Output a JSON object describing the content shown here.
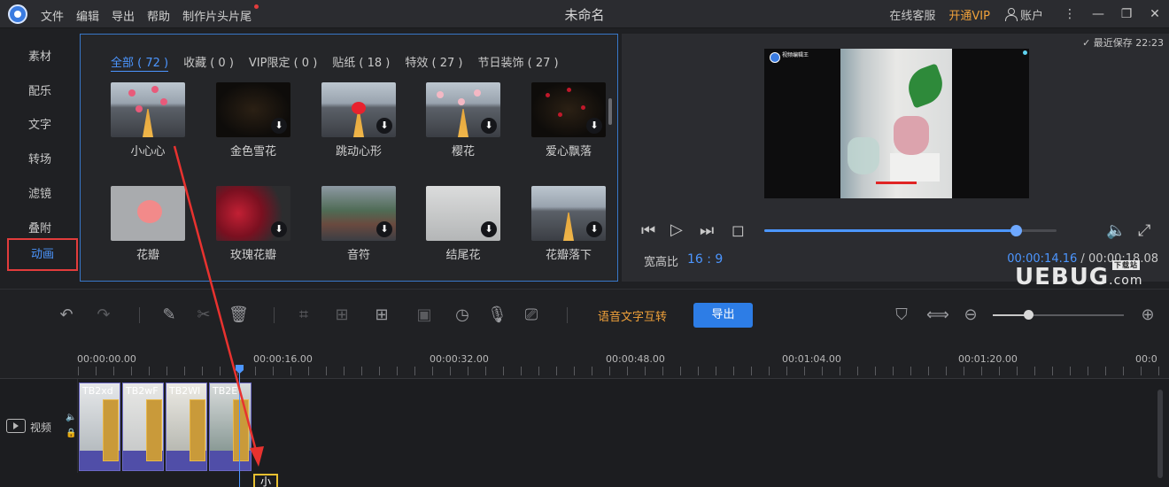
{
  "app": {
    "menu": [
      "文件",
      "编辑",
      "导出",
      "帮助",
      "制作片头片尾"
    ],
    "title": "未命名",
    "online_service": "在线客服",
    "vip": "开通VIP",
    "account": "账户"
  },
  "sidebar": {
    "items": [
      {
        "label": "素材"
      },
      {
        "label": "配乐"
      },
      {
        "label": "文字"
      },
      {
        "label": "转场"
      },
      {
        "label": "滤镜"
      },
      {
        "label": "叠附"
      },
      {
        "label": "动画",
        "active": true
      }
    ]
  },
  "library": {
    "categories": [
      "全部 ( 72 )",
      "收藏 ( 0 )",
      "VIP限定 ( 0 )",
      "贴纸 ( 18 )",
      "特效 ( 27 )",
      "节日装饰 ( 27 )"
    ],
    "items": [
      {
        "label": "小心心",
        "downloaded": true
      },
      {
        "label": "金色雪花",
        "downloaded": false
      },
      {
        "label": "跳动心形",
        "downloaded": false
      },
      {
        "label": "樱花",
        "downloaded": false
      },
      {
        "label": "爱心飘落",
        "downloaded": false
      },
      {
        "label": "花瓣",
        "downloaded": true
      },
      {
        "label": "玫瑰花瓣",
        "downloaded": false
      },
      {
        "label": "音符",
        "downloaded": false
      },
      {
        "label": "结尾花",
        "downloaded": false
      },
      {
        "label": "花瓣落下",
        "downloaded": false
      }
    ]
  },
  "preview": {
    "last_saved": "最近保存 22:23",
    "aspect_label": "宽高比",
    "aspect_value": "16 : 9",
    "current_time": "00:00:14.16",
    "time_separator": "/",
    "total_time": "00:00:18.08",
    "progress": 0.86,
    "watermark": "UEBUG",
    "watermark_suffix": ".com",
    "watermark_badge": "下载站",
    "video_logo_text": "视频编辑王"
  },
  "toolbar": {
    "voice_to_text": "语音文字互转",
    "export": "导出",
    "zoom_level": 0.27
  },
  "timeline": {
    "ruler": [
      "00:00:00.00",
      "00:00:16.00",
      "00:00:32.00",
      "00:00:48.00",
      "00:01:04.00",
      "00:01:20.00",
      "00:0"
    ],
    "track_label": "视频",
    "clips": [
      "TB2xd",
      "TB2wF",
      "TB2Wl",
      "TB2E"
    ],
    "drag_label": "小"
  },
  "colors": {
    "accent": "#4c96ff",
    "vip": "#f0a13a",
    "highlight_box": "#e23c3c",
    "clip": "#504ea8"
  }
}
